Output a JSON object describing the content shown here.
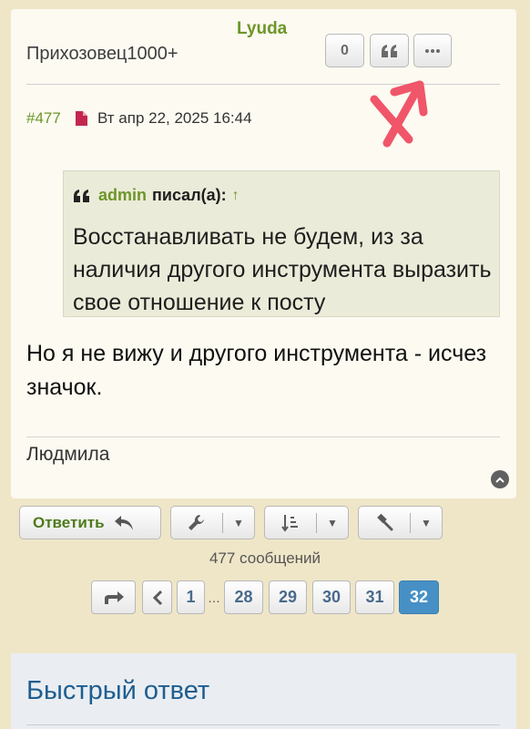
{
  "post": {
    "author": "Lyuda",
    "rank": "Прихозовец1000+",
    "reactions_count": "0",
    "post_number": "#477",
    "date": "Вт апр 22, 2025 16:44",
    "quote": {
      "author": "admin",
      "wrote": "писал(а):",
      "up_arrow": "↑",
      "text": "Восстанавливать не будем, из за наличия другого инструмента выразить свое отношение к посту"
    },
    "body": "Но я не вижу и другого инструмента - исчез значок.",
    "signature": "Людмила",
    "icons": {
      "quote": "quote-icon",
      "more": "ellipsis-icon",
      "file": "file-icon",
      "top": "chevron-up-icon"
    }
  },
  "toolbar": {
    "reply_label": "Ответить",
    "icons": [
      "reply-arrow-icon",
      "wrench-icon",
      "sort-icon",
      "gavel-icon"
    ]
  },
  "pagination": {
    "count_text": "477 сообщений",
    "pages": [
      "1",
      "28",
      "29",
      "30",
      "31",
      "32"
    ],
    "ellipsis": "…",
    "current": "32"
  },
  "quick_reply": {
    "title": "Быстрый ответ"
  },
  "colors": {
    "page_bg": "#efe6c8",
    "post_bg": "#fcfaf1",
    "author_green": "#6e9628",
    "active_page": "#4690c6",
    "annotation_arrow": "#f0556a",
    "link_blue": "#1f5e91"
  }
}
